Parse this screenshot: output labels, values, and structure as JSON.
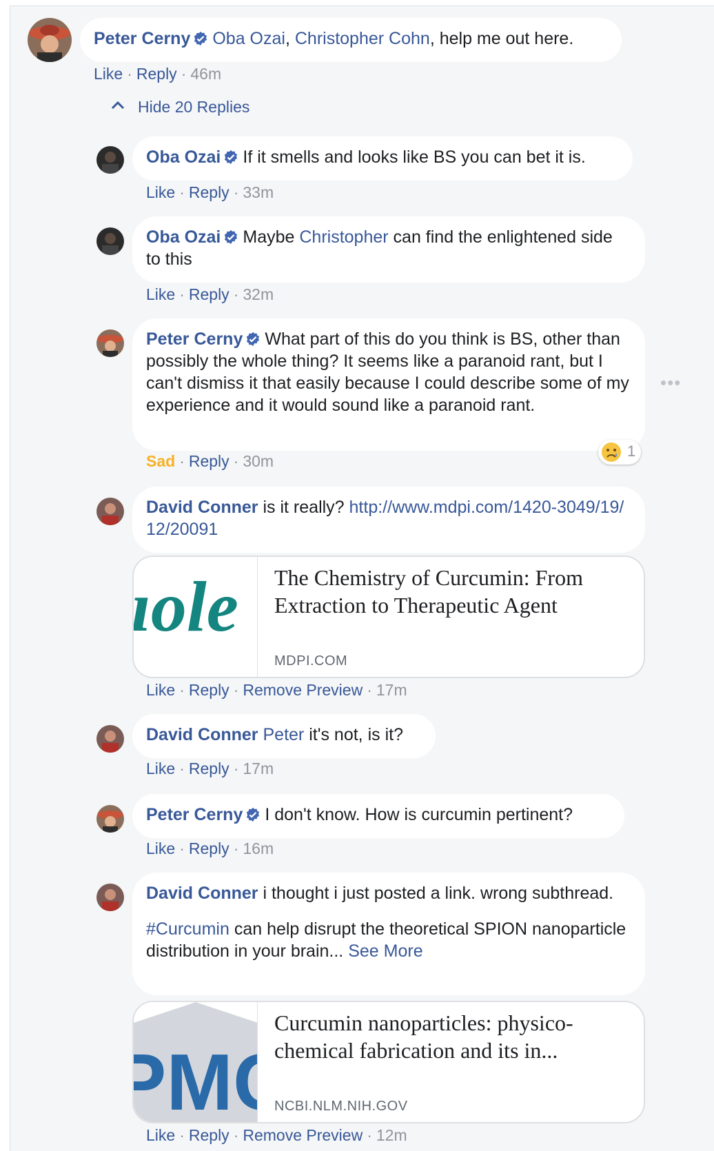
{
  "colors": {
    "link": "#385898",
    "meta": "#90949c",
    "sad": "#f7b125",
    "panel": "#f5f6f7",
    "bubble": "#ffffff",
    "verified": "#4267b2"
  },
  "top_comment": {
    "author": "Peter Cerny",
    "mention1": "Oba Ozai",
    "comma": ",",
    "mention2": "Christopher Cohn",
    "text": ", help me out here.",
    "like": "Like",
    "reply": "Reply",
    "time": "46m"
  },
  "hide_replies": {
    "icon": "chevron-up-icon",
    "label": "Hide 20 Replies"
  },
  "replies": [
    {
      "author": "Oba Ozai",
      "text": "If it smells and looks like BS you can bet it is.",
      "like": "Like",
      "reply": "Reply",
      "time": "33m"
    },
    {
      "author": "Oba Ozai",
      "text_before": "Maybe ",
      "mention": "Christopher",
      "text_after": " can find the enlightened side to this",
      "like": "Like",
      "reply": "Reply",
      "time": "32m"
    },
    {
      "author": "Peter Cerny",
      "text": "What part of this do you think is BS, other than possibly the whole thing? It seems like a paranoid rant, but I can't dismiss it that easily because I could describe some of my experience and it would sound like a paranoid rant.",
      "reaction_label": "Sad",
      "reply": "Reply",
      "time": "30m",
      "reaction_count": "1",
      "reaction_icon": "sad-emoji-icon"
    },
    {
      "author": "David Conner",
      "text": "is it really?",
      "url": "http://www.mdpi.com/1420-3049/19/12/20091",
      "like": "Like",
      "reply": "Reply",
      "remove_preview": "Remove Preview",
      "time": "17m",
      "preview": {
        "title": "The Chemistry of Curcumin: From Extraction to Therapeutic Agent",
        "domain": "MDPI.COM",
        "thumb_text": "ıole"
      }
    },
    {
      "author": "David Conner",
      "mention": "Peter",
      "text": "it's not, is it?",
      "like": "Like",
      "reply": "Reply",
      "time": "17m"
    },
    {
      "author": "Peter Cerny",
      "text": "I don't know. How is curcumin pertinent?",
      "like": "Like",
      "reply": "Reply",
      "time": "16m"
    },
    {
      "author": "David Conner",
      "text": "i thought i just posted a link. wrong subthread.",
      "hashtag": "#Curcumin",
      "text2": " can help disrupt the theoretical SPION nanoparticle distribution in your brain...",
      "see_more": "See More",
      "like": "Like",
      "reply": "Reply",
      "remove_preview": "Remove Preview",
      "time": "12m",
      "preview": {
        "title": "Curcumin nanoparticles: physico-chemical fabrication and its in...",
        "domain": "NCBI.NLM.NIH.GOV",
        "thumb_text": "PMC"
      }
    }
  ]
}
